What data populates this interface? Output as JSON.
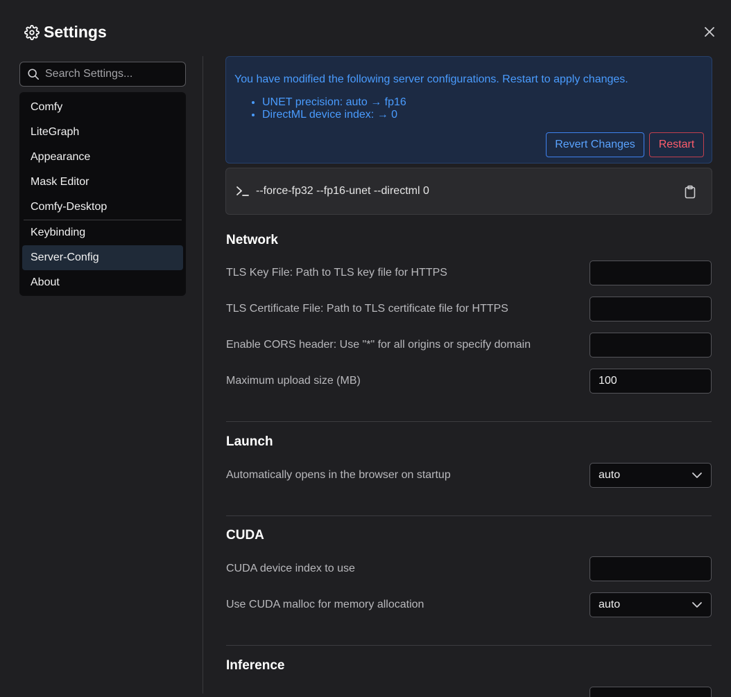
{
  "header": {
    "title": "Settings",
    "icons": {
      "title": "gear-icon",
      "close": "close-icon"
    }
  },
  "sidebar": {
    "search_placeholder": "Search Settings...",
    "items": [
      {
        "label": "Comfy"
      },
      {
        "label": "LiteGraph"
      },
      {
        "label": "Appearance"
      },
      {
        "label": "Mask Editor"
      },
      {
        "label": "Comfy-Desktop"
      },
      {
        "label": "Keybinding"
      },
      {
        "label": "Server-Config",
        "active": true
      },
      {
        "label": "About"
      }
    ]
  },
  "banner": {
    "message": "You have modified the following server configurations. Restart to apply changes.",
    "changes": [
      "UNET precision: auto → fp16",
      "DirectML device index: → 0"
    ],
    "revert_label": "Revert Changes",
    "restart_label": "Restart"
  },
  "command": {
    "text": "--force-fp32 --fp16-unet --directml 0",
    "icons": {
      "prompt": "terminal-icon",
      "copy": "clipboard-icon"
    }
  },
  "sections": {
    "network": {
      "title": "Network",
      "tls_key_label": "TLS Key File: Path to TLS key file for HTTPS",
      "tls_key_value": "",
      "tls_cert_label": "TLS Certificate File: Path to TLS certificate file for HTTPS",
      "tls_cert_value": "",
      "cors_label": "Enable CORS header: Use \"*\" for all origins or specify domain",
      "cors_value": "",
      "upload_label": "Maximum upload size (MB)",
      "upload_value": "100"
    },
    "launch": {
      "title": "Launch",
      "auto_open_label": "Automatically opens in the browser on startup",
      "auto_open_value": "auto"
    },
    "cuda": {
      "title": "CUDA",
      "device_label": "CUDA device index to use",
      "device_value": "",
      "malloc_label": "Use CUDA malloc for memory allocation",
      "malloc_value": "auto"
    },
    "inference": {
      "title": "Inference"
    }
  },
  "colors": {
    "accent": "#4a9cff",
    "danger": "#ff5d6c",
    "background": "#1f1f22",
    "banner_bg": "#1c2a43"
  }
}
